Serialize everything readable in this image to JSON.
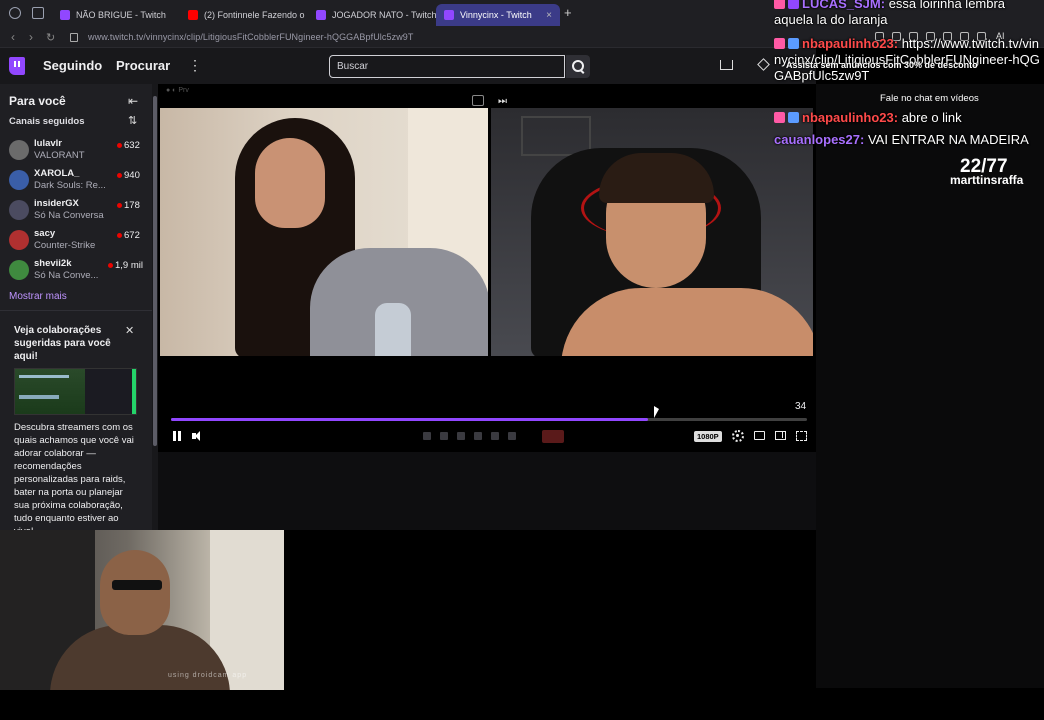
{
  "browser": {
    "tabs": [
      {
        "label": "NÃO BRIGUE - Twitch",
        "active": false,
        "favicon": "#9147ff"
      },
      {
        "label": "(2) Fontinnele Fazendo o",
        "active": false,
        "favicon": "#ff0000"
      },
      {
        "label": "JOGADOR NATO - Twitch",
        "active": false,
        "favicon": "#9147ff"
      },
      {
        "label": "Vinnycinx - Twitch",
        "active": true,
        "favicon": "#9147ff"
      }
    ],
    "url": "www.twitch.tv/vinnycinx/clip/LitigiousFitCobblerFUNgineer-hQGGABpfUlc5zw9T",
    "ai_label": "AI"
  },
  "topnav": {
    "following": "Seguindo",
    "browse": "Procurar",
    "more": "⋮",
    "search_placeholder": "Buscar"
  },
  "sidebar": {
    "title": "Para você",
    "followed_title": "Canais seguidos",
    "channels": [
      {
        "name": "lulavlr",
        "game": "VALORANT",
        "viewers": "632",
        "color": "#6b6b6b"
      },
      {
        "name": "XAROLA_",
        "game": "Dark Souls: Re...",
        "viewers": "940",
        "color": "#3a5ea8"
      },
      {
        "name": "insiderGX",
        "game": "Só Na Conversa",
        "viewers": "178",
        "color": "#4b4b60"
      },
      {
        "name": "sacy",
        "game": "Counter-Strike",
        "viewers": "672",
        "color": "#b03030"
      },
      {
        "name": "shevii2k",
        "game": "Só Na Conve...",
        "viewers": "1,9 mil",
        "color": "#3f8a3f"
      }
    ],
    "show_more": "Mostrar mais",
    "collab_title": "Veja colaborações sugeridas para você aqui!",
    "collab_desc": "Descubra streamers com os quais achamos que você vai adorar colaborar — recomendações personalizadas para raids, bater na porta ou planejar sua próxima colaboração, tudo enquanto estiver ao vivo!"
  },
  "player": {
    "time_right": "34",
    "quality": "1080P",
    "progress_fraction": 0.75
  },
  "webcam": {
    "watermark": "using droidcam app"
  },
  "chat": {
    "messages": [
      {
        "user": "LUCAS_SJM:",
        "text": "essa loirinha lembra aquela la do laranja",
        "color": "#a970ff",
        "badges": [
          "#ff5aa5",
          "#9147ff"
        ]
      },
      {
        "user": "nbapaulinho23:",
        "text": "https://www.twitch.tv/vinnycinx/clip/LitigiousFitCobblerFUNgineer-hQGGABpfUlc5zw9T",
        "color": "#ff4a4a",
        "badges": [
          "#ff5aa5",
          "#5b9bff"
        ]
      },
      {
        "user": "nbapaulinho23:",
        "text": "abre o link",
        "color": "#ff4a4a",
        "badges": [
          "#ff5aa5",
          "#5b9bff"
        ]
      },
      {
        "user": "cauanlopes27:",
        "text": "VAI ENTRAR NA MADEIRA",
        "color": "#a970ff",
        "badges": []
      }
    ],
    "ad_banner": "Assista sem anúncios com 30% de desconto",
    "note": "Fale no chat em vídeos",
    "counter": "22/77",
    "counter_name": "marttinsraffa"
  }
}
